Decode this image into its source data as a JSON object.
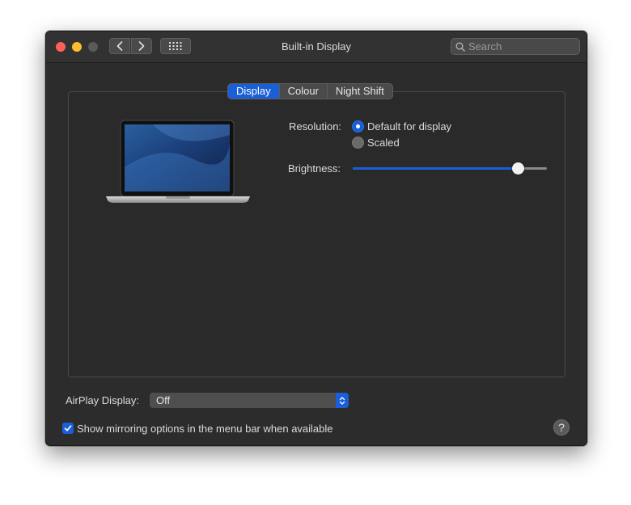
{
  "window": {
    "title": "Built-in Display"
  },
  "search": {
    "placeholder": "Search"
  },
  "tabs": [
    {
      "label": "Display",
      "active": true
    },
    {
      "label": "Colour",
      "active": false
    },
    {
      "label": "Night Shift",
      "active": false
    }
  ],
  "resolution": {
    "label": "Resolution:",
    "options": [
      {
        "label": "Default for display",
        "selected": true
      },
      {
        "label": "Scaled",
        "selected": false
      }
    ]
  },
  "brightness": {
    "label": "Brightness:",
    "value_percent": 85
  },
  "airplay": {
    "label": "AirPlay Display:",
    "selected": "Off"
  },
  "mirroring": {
    "label": "Show mirroring options in the menu bar when available",
    "checked": true
  },
  "help": {
    "glyph": "?"
  },
  "colors": {
    "accent": "#1a5fd8",
    "window_bg": "#2c2c2c",
    "close": "#fe5f57",
    "minimize": "#febc2e"
  },
  "icons": [
    "back-arrow-icon",
    "forward-arrow-icon",
    "grid-icon",
    "search-icon",
    "laptop-icon",
    "chevron-updown-icon",
    "checkmark-icon",
    "help-icon"
  ]
}
